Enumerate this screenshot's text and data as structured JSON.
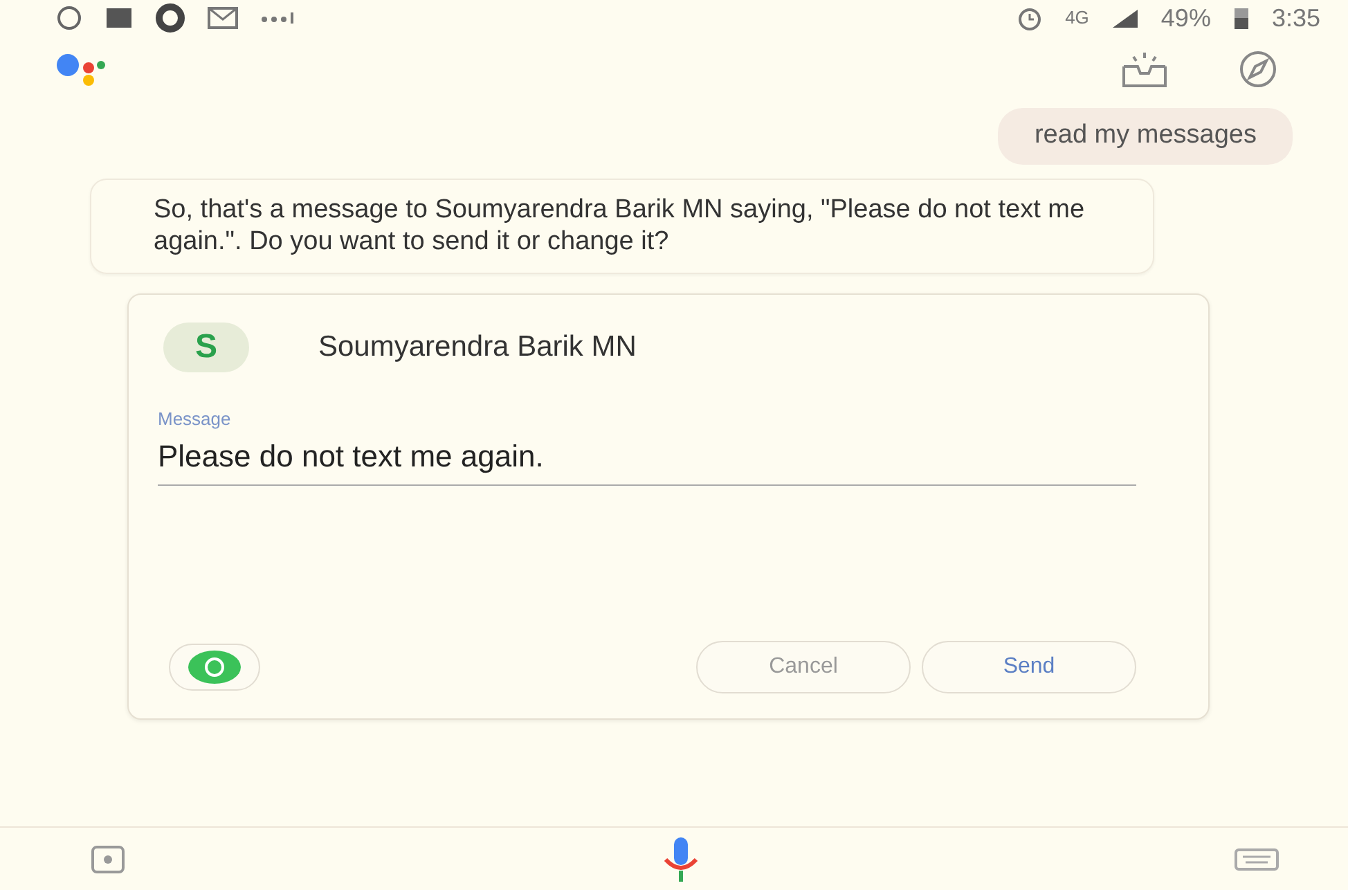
{
  "status_bar": {
    "network": "4G",
    "battery": "49%",
    "time": "3:35"
  },
  "user_message": "read my messages",
  "assistant_message": "So, that's a message to Soumyarendra Barik MN saying, \"Please do not text me again.\". Do you want to send it or change it?",
  "message_card": {
    "avatar_letter": "S",
    "contact": "Soumyarendra Barik MN",
    "field_label": "Message",
    "field_value": "Please do not text me again.",
    "buttons": [
      "Cancel",
      "Send"
    ]
  }
}
